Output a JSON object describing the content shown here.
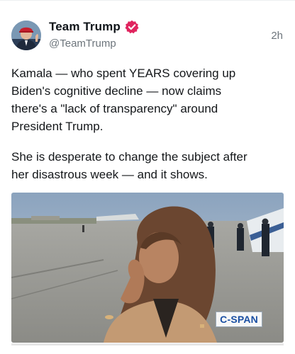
{
  "post": {
    "author": {
      "display_name": "Team Trump",
      "handle": "@TeamTrump",
      "verified_icon": "verified-badge-icon",
      "verified_color": "#e0245e"
    },
    "timestamp": "2h",
    "body": {
      "paragraph_1": "Kamala — who spent YEARS covering up\nBiden's cognitive decline — now claims\nthere's a \"lack of transparency\" around\nPresident Trump.",
      "paragraph_2": "She is desperate to change the subject after\nher disastrous week — and it shows."
    },
    "media": {
      "type": "video-still",
      "watermark": "C-SPAN"
    }
  }
}
